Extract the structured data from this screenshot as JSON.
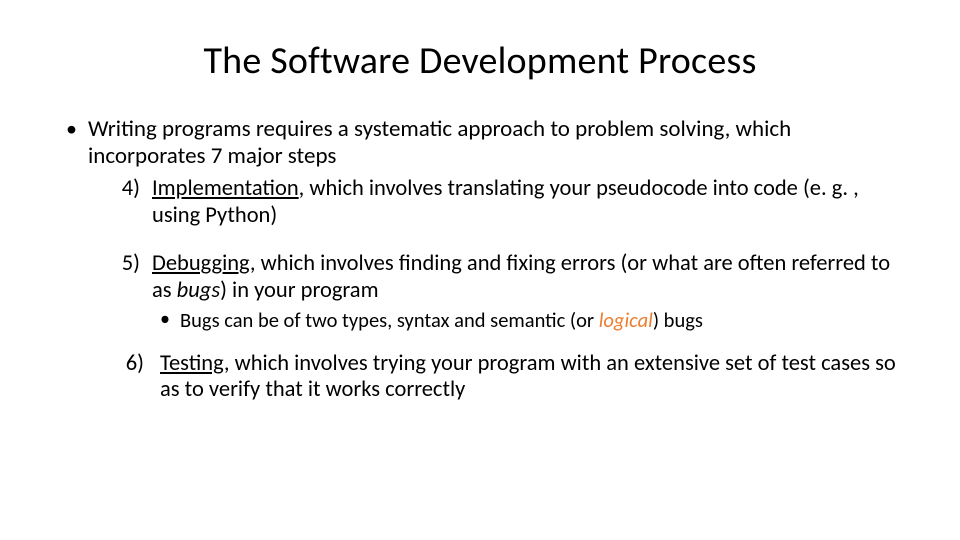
{
  "title": "The Software Development Process",
  "intro": "Writing programs requires a systematic approach to problem solving, which incorporates 7 major steps",
  "items": [
    {
      "num": "4)",
      "keyword": "Implementation",
      "rest": ", which involves translating your pseudocode into code (e. g. , using Python)"
    },
    {
      "num": "5)",
      "keyword": "Debugging",
      "rest_a": ", which involves finding and fixing errors (or what are often referred to as ",
      "rest_b": "bugs",
      "rest_c": ") in your program",
      "sub_a": "Bugs can be of two types, syntax and semantic (or ",
      "sub_accent": "logical",
      "sub_b": ") bugs"
    },
    {
      "num": "6)",
      "keyword": "Testing",
      "rest": ", which involves trying your program with an extensive set of test cases so as to verify that it works correctly"
    }
  ]
}
